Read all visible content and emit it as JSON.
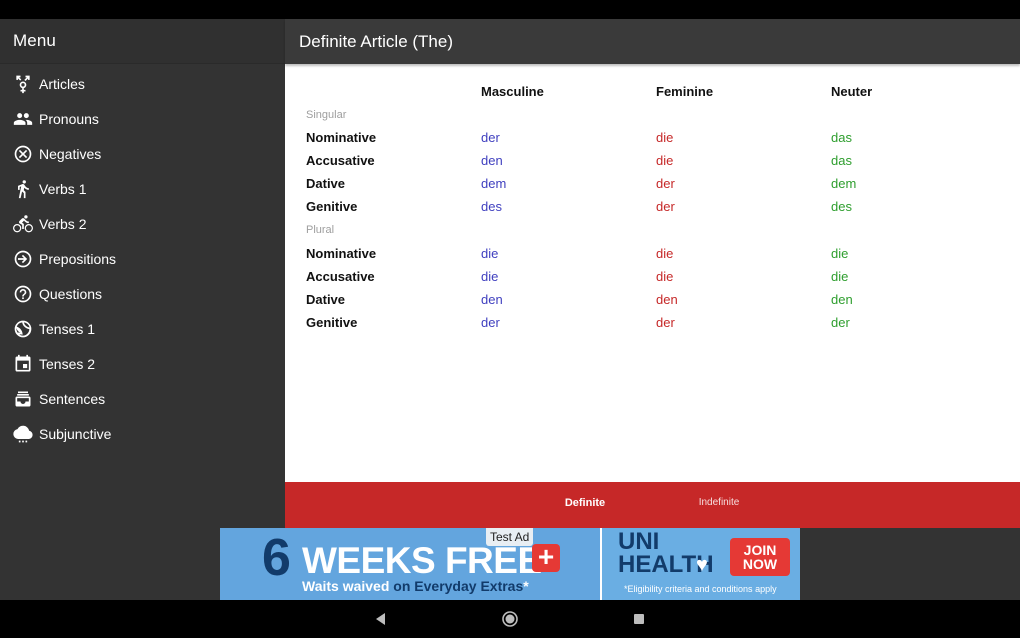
{
  "sidebar": {
    "title": "Menu",
    "items": [
      {
        "label": "Articles",
        "icon": "gender-icon"
      },
      {
        "label": "Pronouns",
        "icon": "people-icon"
      },
      {
        "label": "Negatives",
        "icon": "cancel-circle-icon"
      },
      {
        "label": "Verbs 1",
        "icon": "walk-icon"
      },
      {
        "label": "Verbs 2",
        "icon": "bike-icon"
      },
      {
        "label": "Prepositions",
        "icon": "arrow-circle-icon"
      },
      {
        "label": "Questions",
        "icon": "question-circle-icon"
      },
      {
        "label": "Tenses 1",
        "icon": "tennis-ball-icon"
      },
      {
        "label": "Tenses 2",
        "icon": "calendar-icon"
      },
      {
        "label": "Sentences",
        "icon": "inbox-stack-icon"
      },
      {
        "label": "Subjunctive",
        "icon": "weather-cloud-icon"
      }
    ]
  },
  "main": {
    "title": "Definite Article (The)",
    "columns": [
      "Masculine",
      "Feminine",
      "Neuter"
    ],
    "colors": {
      "masculine": "#3f3fbf",
      "feminine": "#c62828",
      "neuter": "#2e9e2e"
    },
    "sections": [
      {
        "label": "Singular",
        "rows": [
          {
            "case": "Nominative",
            "masc": "der",
            "fem": "die",
            "neut": "das"
          },
          {
            "case": "Accusative",
            "masc": "den",
            "fem": "die",
            "neut": "das"
          },
          {
            "case": "Dative",
            "masc": "dem",
            "fem": "der",
            "neut": "dem"
          },
          {
            "case": "Genitive",
            "masc": "des",
            "fem": "der",
            "neut": "des"
          }
        ]
      },
      {
        "label": "Plural",
        "rows": [
          {
            "case": "Nominative",
            "masc": "die",
            "fem": "die",
            "neut": "die"
          },
          {
            "case": "Accusative",
            "masc": "die",
            "fem": "die",
            "neut": "die"
          },
          {
            "case": "Dative",
            "masc": "den",
            "fem": "den",
            "neut": "den"
          },
          {
            "case": "Genitive",
            "masc": "der",
            "fem": "der",
            "neut": "der"
          }
        ]
      }
    ]
  },
  "tabs": {
    "definite": "Definite",
    "indefinite": "Indefinite",
    "color": "#c62828"
  },
  "ad": {
    "badge": "Test Ad",
    "big_number": "6",
    "headline": "WEEKS FREE",
    "plus": "+",
    "sub_prefix": "Waits waived",
    "sub_accent": "on Everyday Extras",
    "sub_suffix": "*",
    "brand_line1": "UNI",
    "brand_line2": "HEALTH",
    "cta": "JOIN NOW",
    "fine_print": "*Eligibility criteria and conditions apply"
  },
  "nav": {
    "icons": [
      "back-icon",
      "home-icon",
      "recents-icon"
    ]
  }
}
